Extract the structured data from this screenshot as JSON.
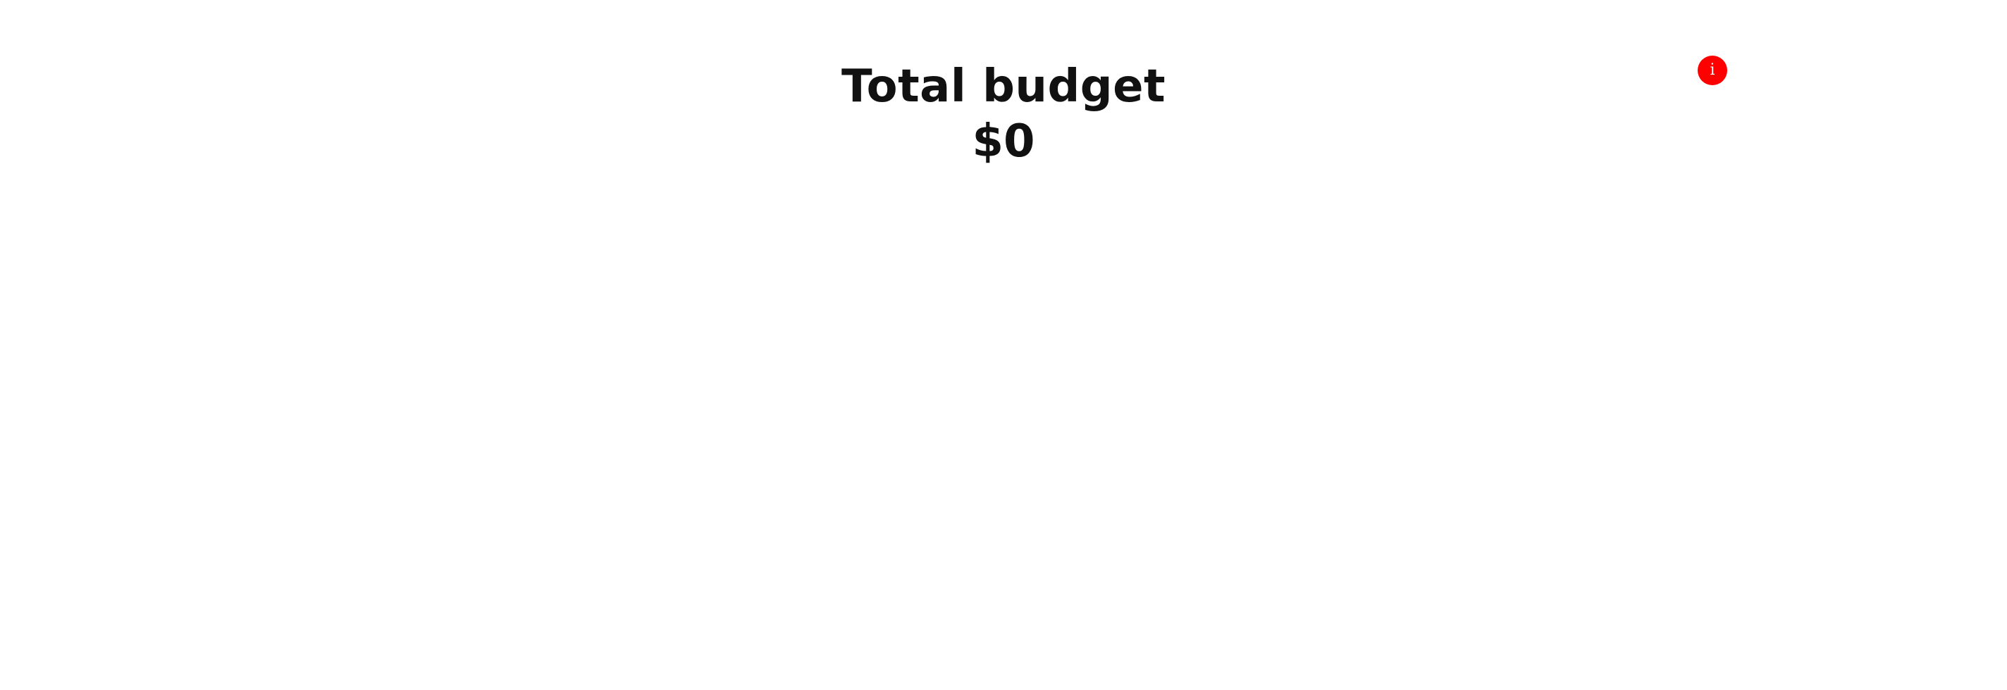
{
  "budget": {
    "title": "Total budget",
    "amount": "$0"
  },
  "info_button": {
    "glyph": "i",
    "icon": "info-icon",
    "color": "#ff0000"
  }
}
